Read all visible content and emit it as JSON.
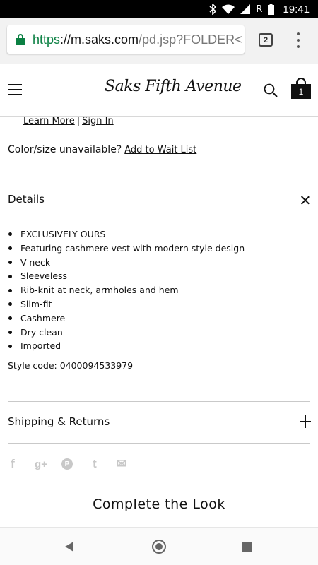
{
  "status_bar": {
    "time": "19:41",
    "icons": [
      "bluetooth-icon",
      "wifi-icon",
      "signal-icon",
      "roaming-r-icon",
      "battery-icon"
    ],
    "roaming_label": "R"
  },
  "browser": {
    "url_scheme": "https",
    "url_host": "://m.saks.com",
    "url_path": "/pd.jsp?FOLDER<",
    "tab_count": "2"
  },
  "header": {
    "logo_text": "Saks Fifth Avenue",
    "bag_count": "1"
  },
  "account_links": {
    "learn_more": "Learn More",
    "separator": "|",
    "sign_in": "Sign In"
  },
  "waitlist": {
    "label": "Color/size unavailable?",
    "link": "Add to Wait List"
  },
  "details": {
    "heading": "Details",
    "items": [
      "EXCLUSIVELY OURS",
      "Featuring cashmere vest with modern style design",
      "V-neck",
      "Sleeveless",
      "Rib-knit at neck, armholes and hem",
      "Slim-fit",
      "Cashmere",
      "Dry clean",
      "Imported"
    ],
    "style_code": "Style code: 0400094533979"
  },
  "shipping": {
    "heading": "Shipping & Returns"
  },
  "social": {
    "icons": [
      {
        "name": "facebook-icon",
        "glyph": "f"
      },
      {
        "name": "google-plus-icon",
        "glyph": "g+"
      },
      {
        "name": "pinterest-icon",
        "glyph": "P"
      },
      {
        "name": "twitter-icon",
        "glyph": "t"
      },
      {
        "name": "email-icon",
        "glyph": "✉"
      }
    ],
    "color": "#c8c8c8"
  },
  "complete_look": {
    "heading": "Complete the Look"
  },
  "colors": {
    "secure_green": "#0b8043",
    "divider": "#c9c9c9"
  }
}
